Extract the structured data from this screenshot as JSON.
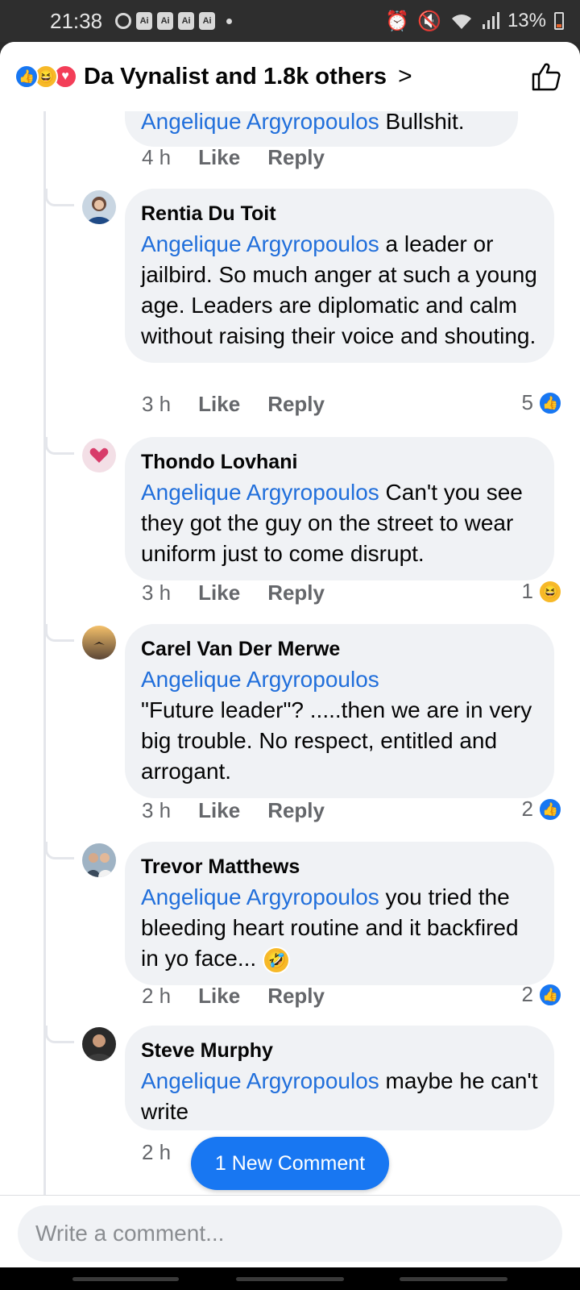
{
  "status_bar": {
    "time": "21:38",
    "ai_badges": [
      "Ai",
      "Ai",
      "Ai",
      "Ai"
    ],
    "battery": "13%"
  },
  "header": {
    "reactors": "Da Vynalist and 1.8k others",
    "reaction_icons": [
      "like-icon",
      "haha-icon",
      "love-icon"
    ]
  },
  "top_comment": {
    "mention": "Angelique Argyropoulos",
    "text": " Bullshit.",
    "time": "4 h",
    "like": "Like",
    "reply": "Reply"
  },
  "comments": [
    {
      "author": "Rentia Du Toit",
      "mention": "Angelique Argyropoulos",
      "text": " a leader or jailbird.  So much anger at such a young age.  Leaders are diplomatic and calm without raising their voice and shouting.",
      "time": "3 h",
      "like": "Like",
      "reply": "Reply",
      "reaction_count": "5",
      "reaction": "like"
    },
    {
      "author": "Thondo Lovhani",
      "mention": "Angelique Argyropoulos",
      "text": " Can't you see they got the guy on the street to wear uniform just to come disrupt.",
      "time": "3 h",
      "like": "Like",
      "reply": "Reply",
      "reaction_count": "1",
      "reaction": "haha"
    },
    {
      "author": "Carel Van Der Merwe",
      "mention": "Angelique Argyropoulos",
      "text": "\"Future leader\"? .....then we are in very big trouble. No respect, entitled and arrogant.",
      "time": "3 h",
      "like": "Like",
      "reply": "Reply",
      "reaction_count": "2",
      "reaction": "like"
    },
    {
      "author": "Trevor Matthews",
      "mention": "Angelique Argyropoulos",
      "text": " you tried the bleeding heart routine and it backfired in yo face...",
      "time": "2 h",
      "like": "Like",
      "reply": "Reply",
      "reaction_count": "2",
      "reaction": "like"
    },
    {
      "author": "Steve Murphy",
      "mention": "Angelique Argyropoulos",
      "text": " maybe he can't write",
      "time": "2 h"
    }
  ],
  "new_comment_button": "1 New Comment",
  "composer": {
    "placeholder": "Write a comment..."
  },
  "colors": {
    "accent": "#1877f2",
    "mention": "#216fdb",
    "bubble": "#f0f2f5"
  }
}
